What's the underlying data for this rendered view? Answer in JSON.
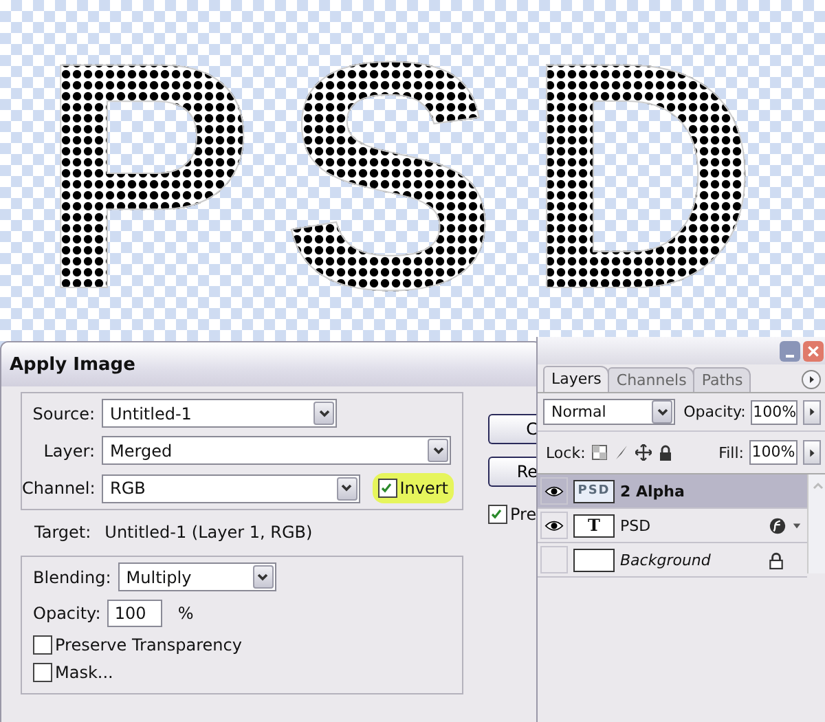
{
  "canvas": {
    "artwork_text": "PSD"
  },
  "dialog": {
    "title": "Apply Image",
    "source": {
      "label": "Source:",
      "value": "Untitled-1"
    },
    "layer": {
      "label": "Layer:",
      "value": "Merged"
    },
    "channel": {
      "label": "Channel:",
      "value": "RGB"
    },
    "invert": {
      "label": "Invert",
      "checked": true,
      "highlighted": true
    },
    "target": {
      "label": "Target:",
      "value": "Untitled-1 (Layer 1, RGB)"
    },
    "blending": {
      "label": "Blending:",
      "value": "Multiply"
    },
    "opacity": {
      "label": "Opacity:",
      "value": "100",
      "unit": "%"
    },
    "options": [
      {
        "label": "Preserve Transparency",
        "checked": false
      },
      {
        "label": "Mask...",
        "checked": false
      }
    ],
    "buttons": [
      "C",
      "Re"
    ],
    "preview": {
      "label": "Pre",
      "checked": true
    }
  },
  "layers_panel": {
    "tabs": [
      {
        "label": "Layers",
        "selected": true
      },
      {
        "label": "Channels",
        "selected": false
      },
      {
        "label": "Paths",
        "selected": false
      }
    ],
    "blend_mode": "Normal",
    "opacity": {
      "label": "Opacity:",
      "value": "100%"
    },
    "lock_label": "Lock:",
    "fill": {
      "label": "Fill:",
      "value": "100%"
    },
    "layers": [
      {
        "name": "2 Alpha",
        "kind": "alpha",
        "thumb_text": "PSD",
        "visible": true,
        "selected": true
      },
      {
        "name": "PSD",
        "kind": "type",
        "thumb_text": "T",
        "visible": true,
        "selected": false,
        "effects": true
      },
      {
        "name": "Background",
        "kind": "background",
        "visible": false,
        "selected": false,
        "locked": true
      }
    ]
  }
}
